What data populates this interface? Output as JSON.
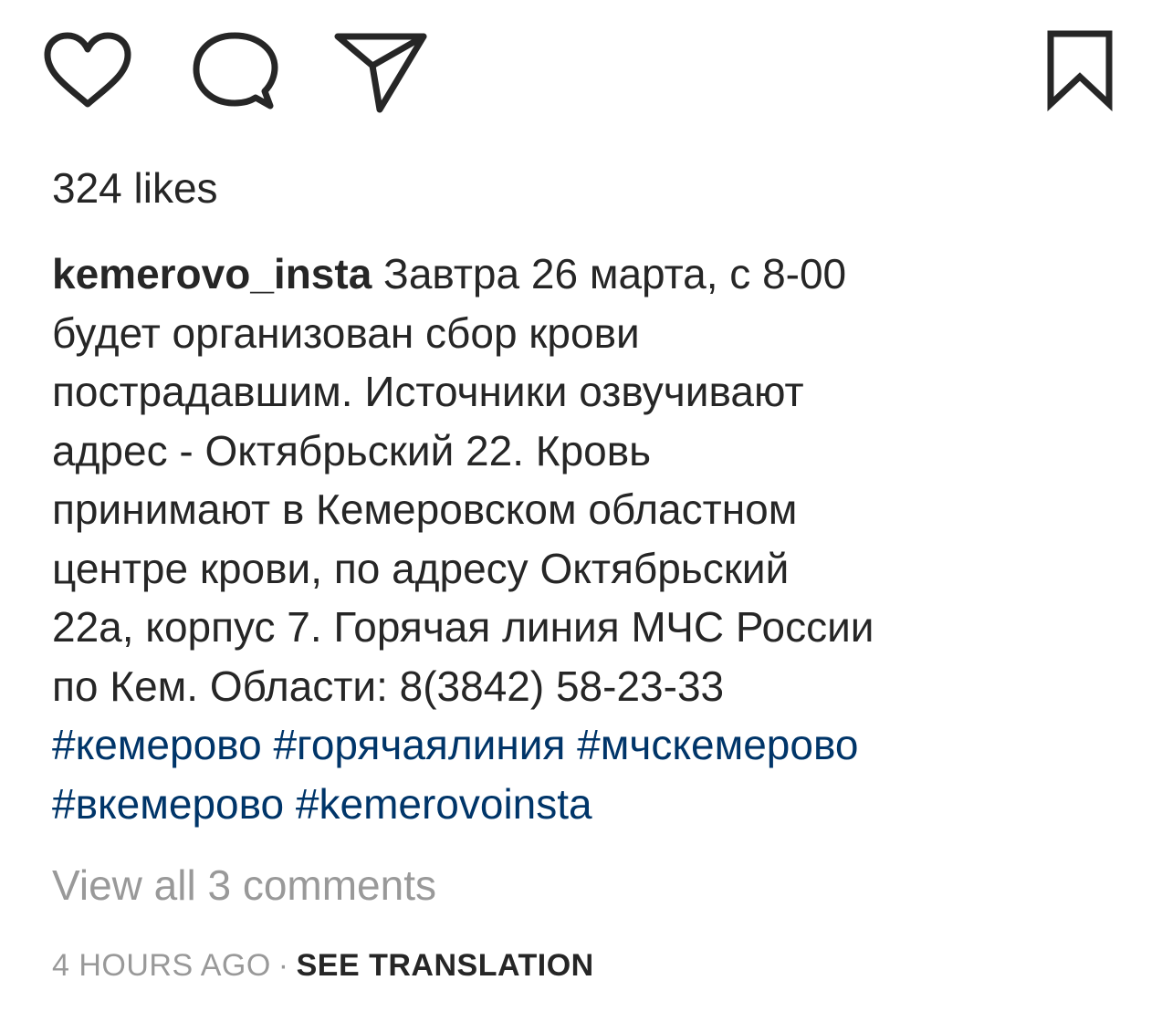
{
  "actions": {
    "like_icon": "heart-icon",
    "comment_icon": "comment-bubble-icon",
    "share_icon": "paper-plane-icon",
    "save_icon": "bookmark-icon"
  },
  "post": {
    "likes": "324 likes",
    "username": "kemerovo_insta",
    "caption_lines": [
      " Завтра 26 марта, с 8-00",
      "будет организован сбор крови",
      "пострадавшим. Источники озвучивают",
      "адрес - Октябрьский 22. Кровь",
      "принимают в Кемеровском областном",
      "центре крови, по адресу Октябрьский",
      "22а, корпус 7. Горячая линия МЧС России",
      "по Кем. Области: 8(3842) 58-23-33"
    ],
    "hashtags": {
      "line1": [
        "#кемерово",
        "#горячаялиния",
        "#мчскемерово"
      ],
      "line2": [
        "#вкемерово",
        "#kemerovoinsta"
      ]
    },
    "view_comments": "View all 3 comments",
    "timestamp": "4 HOURS AGO",
    "separator": "·",
    "translation_link": "SEE TRANSLATION"
  },
  "colors": {
    "text": "#262626",
    "hashtag": "#003569",
    "muted": "#999999",
    "background": "#ffffff"
  }
}
